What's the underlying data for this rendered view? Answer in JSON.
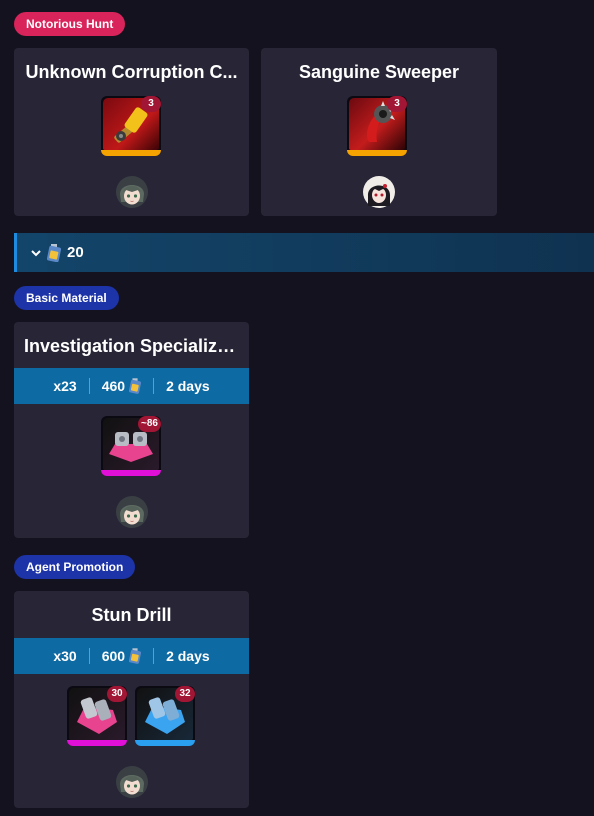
{
  "sections": {
    "notorious_hunt": "Notorious Hunt",
    "basic_material": "Basic Material",
    "agent_promotion": "Agent Promotion"
  },
  "hunt_cards": [
    {
      "title": "Unknown Corruption C...",
      "item_count": "3",
      "item_icon": "yellow-weapon-icon",
      "rarity_color": "#f5a300",
      "avatar": "grey-hair-agent-avatar"
    },
    {
      "title": "Sanguine Sweeper",
      "item_count": "3",
      "item_icon": "red-blade-icon",
      "rarity_color": "#f5a300",
      "avatar": "dark-hair-agent-avatar"
    }
  ],
  "battery_group": {
    "icon": "battery-icon",
    "value": "20"
  },
  "material_card": {
    "title": "Investigation Specializa...",
    "stats": {
      "runs": "x23",
      "energy": "460",
      "time": "2 days"
    },
    "item_count": "~86",
    "item_icon": "pink-chip-icon",
    "rarity_color": "#e010d8",
    "avatar": "grey-hair-agent-avatar"
  },
  "promotion_card": {
    "title": "Stun Drill",
    "stats": {
      "runs": "x30",
      "energy": "600",
      "time": "2 days"
    },
    "items": [
      {
        "count": "30",
        "icon": "pink-drill-icon",
        "rarity_color": "#e010d8"
      },
      {
        "count": "32",
        "icon": "blue-drill-icon",
        "rarity_color": "#2a9ff0"
      }
    ],
    "avatar": "grey-hair-agent-avatar"
  }
}
